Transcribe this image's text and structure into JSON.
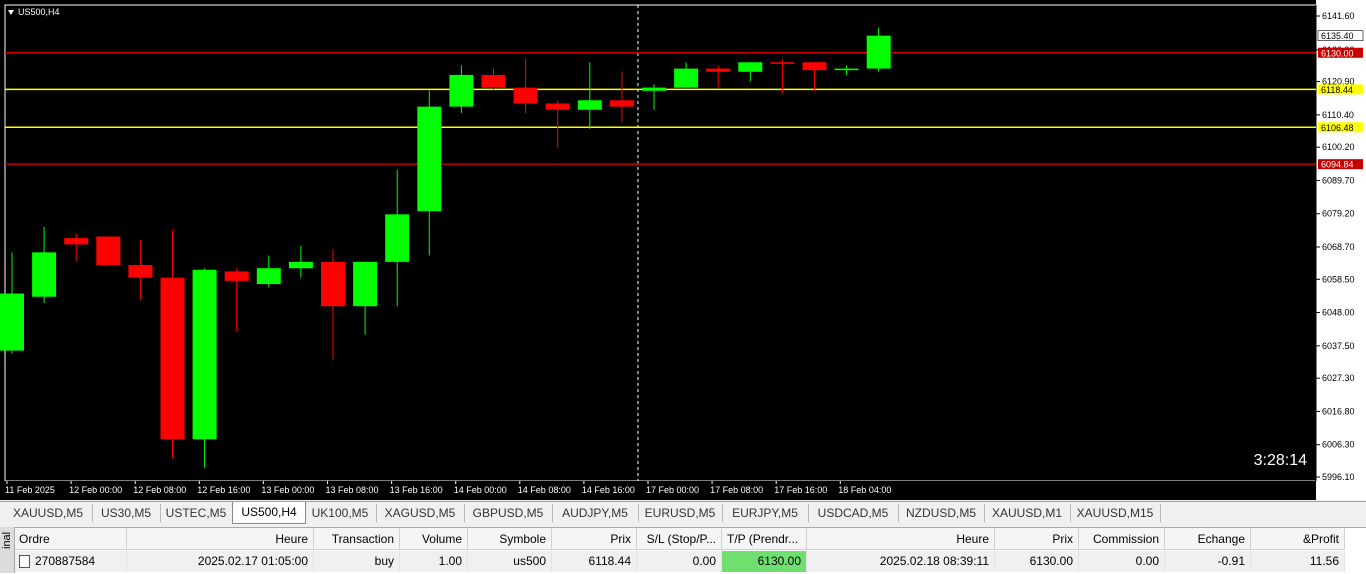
{
  "window": {
    "symbol_title": "US500,H4",
    "timer": "3:28:14"
  },
  "colors": {
    "background": "#000000",
    "bull": "#00ff00",
    "bear": "#ff0000",
    "tp_line": "#c80000",
    "sl_line": "#ffff00",
    "grid_text": "#000000",
    "tp_cell": "#6fdf6f"
  },
  "price_axis": {
    "ticks": [
      "6141.60",
      "6130.90",
      "6120.90",
      "6110.40",
      "6100.20",
      "6089.70",
      "6079.20",
      "6068.70",
      "6058.50",
      "6048.00",
      "6037.50",
      "6027.30",
      "6016.80",
      "6006.30",
      "5996.10"
    ],
    "current_price": "6135.40"
  },
  "time_axis": {
    "labels": [
      "11 Feb 2025",
      "12 Feb 00:00",
      "12 Feb 08:00",
      "12 Feb 16:00",
      "13 Feb 00:00",
      "13 Feb 08:00",
      "13 Feb 16:00",
      "14 Feb 00:00",
      "14 Feb 08:00",
      "14 Feb 16:00",
      "17 Feb 00:00",
      "17 Feb 08:00",
      "17 Feb 16:00",
      "18 Feb 04:00"
    ]
  },
  "price_lines": [
    {
      "label": "6130.00",
      "price": 6130.0,
      "color": "#c80000",
      "tag_bg": "#c80000",
      "tag_fg": "#ffffff"
    },
    {
      "label": "6118.44",
      "price": 6118.44,
      "color": "#ffff00",
      "tag_bg": "#ffff00",
      "tag_fg": "#000000"
    },
    {
      "label": "6106.48",
      "price": 6106.48,
      "color": "#ffff00",
      "tag_bg": "#ffff00",
      "tag_fg": "#000000"
    },
    {
      "label": "6094.84",
      "price": 6094.84,
      "color": "#c80000",
      "tag_bg": "#c80000",
      "tag_fg": "#ffffff"
    }
  ],
  "chart_data": {
    "type": "candlestick",
    "symbol": "US500",
    "timeframe": "H4",
    "ylim": [
      5996.1,
      6141.6
    ],
    "candles": [
      {
        "o": 6036.0,
        "h": 6067.0,
        "l": 6035.0,
        "c": 6054.0
      },
      {
        "o": 6053.0,
        "h": 6075.0,
        "l": 6051.0,
        "c": 6067.0
      },
      {
        "o": 6071.5,
        "h": 6073.0,
        "l": 6064.0,
        "c": 6069.5
      },
      {
        "o": 6072.0,
        "h": 6072.0,
        "l": 6063.0,
        "c": 6063.0
      },
      {
        "o": 6063.0,
        "h": 6071.0,
        "l": 6052.0,
        "c": 6059.0
      },
      {
        "o": 6059.0,
        "h": 6074.0,
        "l": 6002.0,
        "c": 6008.0
      },
      {
        "o": 6008.0,
        "h": 6062.0,
        "l": 5999.0,
        "c": 6061.5
      },
      {
        "o": 6061.0,
        "h": 6062.0,
        "l": 6042.0,
        "c": 6058.0
      },
      {
        "o": 6057.0,
        "h": 6066.0,
        "l": 6056.0,
        "c": 6062.0
      },
      {
        "o": 6062.0,
        "h": 6069.0,
        "l": 6059.0,
        "c": 6064.0
      },
      {
        "o": 6064.0,
        "h": 6068.0,
        "l": 6033.0,
        "c": 6050.0
      },
      {
        "o": 6050.0,
        "h": 6064.0,
        "l": 6041.0,
        "c": 6064.0
      },
      {
        "o": 6064.0,
        "h": 6093.0,
        "l": 6050.0,
        "c": 6079.0
      },
      {
        "o": 6080.0,
        "h": 6118.0,
        "l": 6066.0,
        "c": 6113.0
      },
      {
        "o": 6113.0,
        "h": 6126.0,
        "l": 6111.0,
        "c": 6123.0
      },
      {
        "o": 6123.0,
        "h": 6125.0,
        "l": 6118.0,
        "c": 6119.0
      },
      {
        "o": 6119.0,
        "h": 6128.0,
        "l": 6111.0,
        "c": 6114.0
      },
      {
        "o": 6114.0,
        "h": 6115.0,
        "l": 6100.0,
        "c": 6112.0
      },
      {
        "o": 6112.0,
        "h": 6127.0,
        "l": 6106.0,
        "c": 6115.0
      },
      {
        "o": 6115.0,
        "h": 6124.0,
        "l": 6108.0,
        "c": 6113.0
      },
      {
        "o": 6118.0,
        "h": 6120.0,
        "l": 6112.0,
        "c": 6119.0
      },
      {
        "o": 6119.0,
        "h": 6127.0,
        "l": 6119.0,
        "c": 6125.0
      },
      {
        "o": 6125.0,
        "h": 6126.0,
        "l": 6119.0,
        "c": 6124.0
      },
      {
        "o": 6124.0,
        "h": 6127.0,
        "l": 6121.0,
        "c": 6127.0
      },
      {
        "o": 6127.0,
        "h": 6128.0,
        "l": 6117.0,
        "c": 6126.5
      },
      {
        "o": 6127.0,
        "h": 6127.0,
        "l": 6118.0,
        "c": 6124.5
      },
      {
        "o": 6124.5,
        "h": 6126.0,
        "l": 6123.0,
        "c": 6125.0
      },
      {
        "o": 6125.0,
        "h": 6138.0,
        "l": 6124.0,
        "c": 6135.4
      }
    ]
  },
  "tabs": [
    {
      "label": "XAUUSD,M5",
      "active": false
    },
    {
      "label": "US30,M5",
      "active": false
    },
    {
      "label": "USTEC,M5",
      "active": false
    },
    {
      "label": "US500,H4",
      "active": true
    },
    {
      "label": "UK100,M5",
      "active": false
    },
    {
      "label": "XAGUSD,M5",
      "active": false
    },
    {
      "label": "GBPUSD,M5",
      "active": false
    },
    {
      "label": "AUDJPY,M5",
      "active": false
    },
    {
      "label": "EURUSD,M5",
      "active": false
    },
    {
      "label": "EURJPY,M5",
      "active": false
    },
    {
      "label": "USDCAD,M5",
      "active": false
    },
    {
      "label": "NZDUSD,M5",
      "active": false
    },
    {
      "label": "XAUUSD,M1",
      "active": false
    },
    {
      "label": "XAUUSD,M15",
      "active": false
    }
  ],
  "terminal": {
    "side_label": "inal",
    "columns": [
      "Ordre",
      "Heure",
      "Transaction",
      "Volume",
      "Symbole",
      "Prix",
      "S/L (Stop/P...",
      "T/P (Prendr...",
      "Heure",
      "Prix",
      "Commission",
      "Echange",
      "&Profit"
    ],
    "rows": [
      [
        "270887584",
        "2025.02.17 01:05:00",
        "buy",
        "1.00",
        "us500",
        "6118.44",
        "0.00",
        "6130.00",
        "2025.02.18 08:39:11",
        "6130.00",
        "0.00",
        "-0.91",
        "11.56"
      ]
    ]
  }
}
